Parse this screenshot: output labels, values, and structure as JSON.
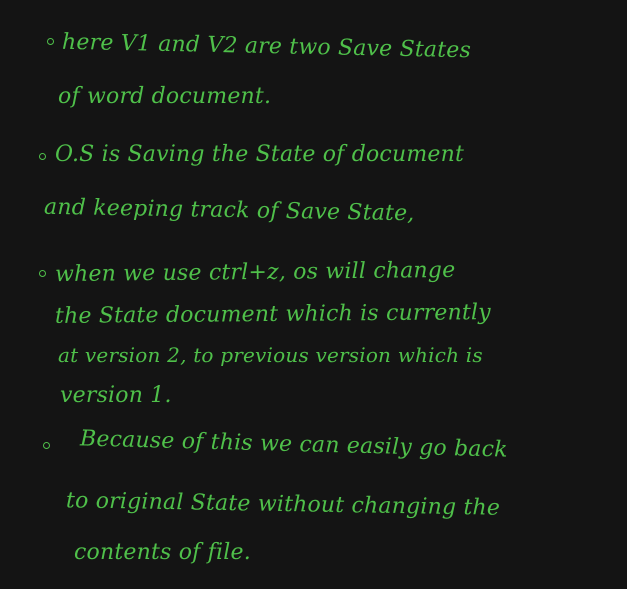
{
  "notes": {
    "bullet_1": {
      "line_1": "here V1 and V2 are two Save States",
      "line_2": "of word document."
    },
    "bullet_2": {
      "line_1": "O.S is Saving the State of document",
      "line_2": "and keeping track of Save State,"
    },
    "bullet_3": {
      "line_1": "when we use ctrl+z, os will change",
      "line_2": "the State document which is currently",
      "line_3": "at version 2, to previous version which is",
      "line_4": "version 1."
    },
    "bullet_4": {
      "line_1": "Because of this we can easily go back",
      "line_2": "to original State without changing the",
      "line_3": "contents of file."
    }
  },
  "colors": {
    "background": "#141414",
    "ink": "#4fc04a"
  }
}
